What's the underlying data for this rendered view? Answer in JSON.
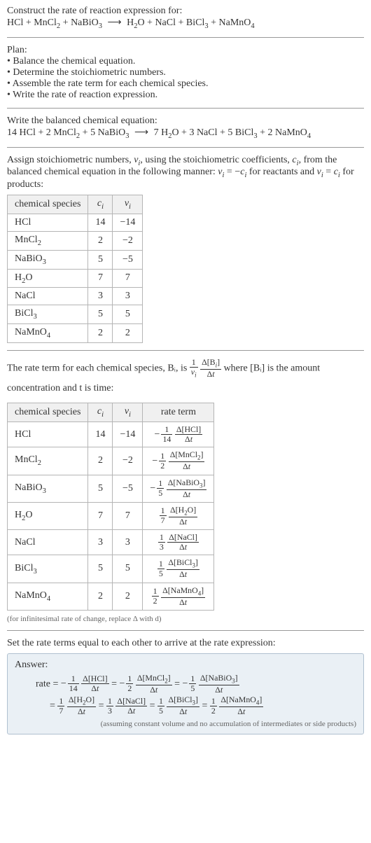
{
  "prompt": {
    "line1": "Construct the rate of reaction expression for:",
    "equation": "HCl + MnCl₂ + NaBiO₃  ⟶  H₂O + NaCl + BiCl₃ + NaMnO₄"
  },
  "plan": {
    "heading": "Plan:",
    "items": [
      "• Balance the chemical equation.",
      "• Determine the stoichiometric numbers.",
      "• Assemble the rate term for each chemical species.",
      "• Write the rate of reaction expression."
    ]
  },
  "balanced": {
    "heading": "Write the balanced chemical equation:",
    "equation": "14 HCl + 2 MnCl₂ + 5 NaBiO₃  ⟶  7 H₂O + 3 NaCl + 5 BiCl₃ + 2 NaMnO₄"
  },
  "stoich_intro": "Assign stoichiometric numbers, νᵢ, using the stoichiometric coefficients, cᵢ, from the balanced chemical equation in the following manner: νᵢ = −cᵢ for reactants and νᵢ = cᵢ for products:",
  "table1": {
    "headers": {
      "species": "chemical species",
      "c": "cᵢ",
      "nu": "νᵢ"
    }
  },
  "rate_intro_a": "The rate term for each chemical species, Bᵢ, is ",
  "rate_intro_b": " where [Bᵢ] is the amount concentration and t is time:",
  "table2": {
    "headers": {
      "species": "chemical species",
      "c": "cᵢ",
      "nu": "νᵢ",
      "rate": "rate term"
    }
  },
  "infinitesimal_note": "(for infinitesimal rate of change, replace Δ with d)",
  "final_heading": "Set the rate terms equal to each other to arrive at the rate expression:",
  "answer": {
    "label": "Answer:",
    "note": "(assuming constant volume and no accumulation of intermediates or side products)"
  },
  "chart_data": {
    "type": "table",
    "species_table": {
      "headers": [
        "chemical species",
        "cᵢ",
        "νᵢ"
      ],
      "rows": [
        {
          "species": "HCl",
          "c": 14,
          "nu": -14
        },
        {
          "species": "MnCl₂",
          "c": 2,
          "nu": -2
        },
        {
          "species": "NaBiO₃",
          "c": 5,
          "nu": -5
        },
        {
          "species": "H₂O",
          "c": 7,
          "nu": 7
        },
        {
          "species": "NaCl",
          "c": 3,
          "nu": 3
        },
        {
          "species": "BiCl₃",
          "c": 5,
          "nu": 5
        },
        {
          "species": "NaMnO₄",
          "c": 2,
          "nu": 2
        }
      ]
    },
    "rate_table": {
      "headers": [
        "chemical species",
        "cᵢ",
        "νᵢ",
        "rate term"
      ],
      "rows": [
        {
          "species": "HCl",
          "c": 14,
          "nu": -14,
          "sign": "−",
          "coef_num": "1",
          "coef_den": "14",
          "delta": "Δ[HCl]"
        },
        {
          "species": "MnCl₂",
          "c": 2,
          "nu": -2,
          "sign": "−",
          "coef_num": "1",
          "coef_den": "2",
          "delta": "Δ[MnCl₂]"
        },
        {
          "species": "NaBiO₃",
          "c": 5,
          "nu": -5,
          "sign": "−",
          "coef_num": "1",
          "coef_den": "5",
          "delta": "Δ[NaBiO₃]"
        },
        {
          "species": "H₂O",
          "c": 7,
          "nu": 7,
          "sign": "",
          "coef_num": "1",
          "coef_den": "7",
          "delta": "Δ[H₂O]"
        },
        {
          "species": "NaCl",
          "c": 3,
          "nu": 3,
          "sign": "",
          "coef_num": "1",
          "coef_den": "3",
          "delta": "Δ[NaCl]"
        },
        {
          "species": "BiCl₃",
          "c": 5,
          "nu": 5,
          "sign": "",
          "coef_num": "1",
          "coef_den": "5",
          "delta": "Δ[BiCl₃]"
        },
        {
          "species": "NaMnO₄",
          "c": 2,
          "nu": 2,
          "sign": "",
          "coef_num": "1",
          "coef_den": "2",
          "delta": "Δ[NaMnO₄]"
        }
      ]
    },
    "rate_expression": {
      "lhs": "rate",
      "terms": [
        {
          "sign": "−",
          "num": "1",
          "den": "14",
          "delta": "Δ[HCl]"
        },
        {
          "sign": "−",
          "num": "1",
          "den": "2",
          "delta": "Δ[MnCl₂]"
        },
        {
          "sign": "−",
          "num": "1",
          "den": "5",
          "delta": "Δ[NaBiO₃]"
        },
        {
          "sign": "",
          "num": "1",
          "den": "7",
          "delta": "Δ[H₂O]"
        },
        {
          "sign": "",
          "num": "1",
          "den": "3",
          "delta": "Δ[NaCl]"
        },
        {
          "sign": "",
          "num": "1",
          "den": "5",
          "delta": "Δ[BiCl₃]"
        },
        {
          "sign": "",
          "num": "1",
          "den": "2",
          "delta": "Δ[NaMnO₄]"
        }
      ]
    }
  }
}
